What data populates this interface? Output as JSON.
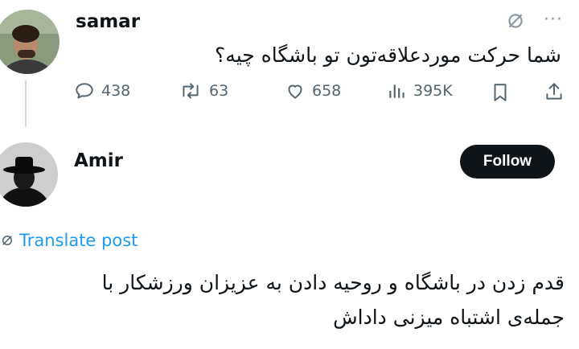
{
  "original_tweet": {
    "username": "samar",
    "text": "شما حرکت موردعلاقه‌تون تو باشگاه چیه؟",
    "actions": {
      "replies": "438",
      "retweets": "63",
      "likes": "658",
      "views": "395K"
    }
  },
  "reply": {
    "username": "Amir",
    "follow_label": "Follow",
    "translate_label": "Translate post",
    "text_lines": [
      "قدم زدن در باشگاه و روحیه دادن به عزیزان ورزشکار با",
      "جمله‌ی اشتباه میزنی داداش"
    ]
  },
  "colors": {
    "text": "#0f1419",
    "secondary": "#536471",
    "link": "#1d9bf0",
    "button": "#0f1419",
    "thread_line": "#cfd9de"
  },
  "icons": [
    "reply-icon",
    "retweet-icon",
    "like-icon",
    "views-icon",
    "bookmark-icon",
    "share-icon",
    "grok-icon",
    "more-icon",
    "translate-icon"
  ]
}
